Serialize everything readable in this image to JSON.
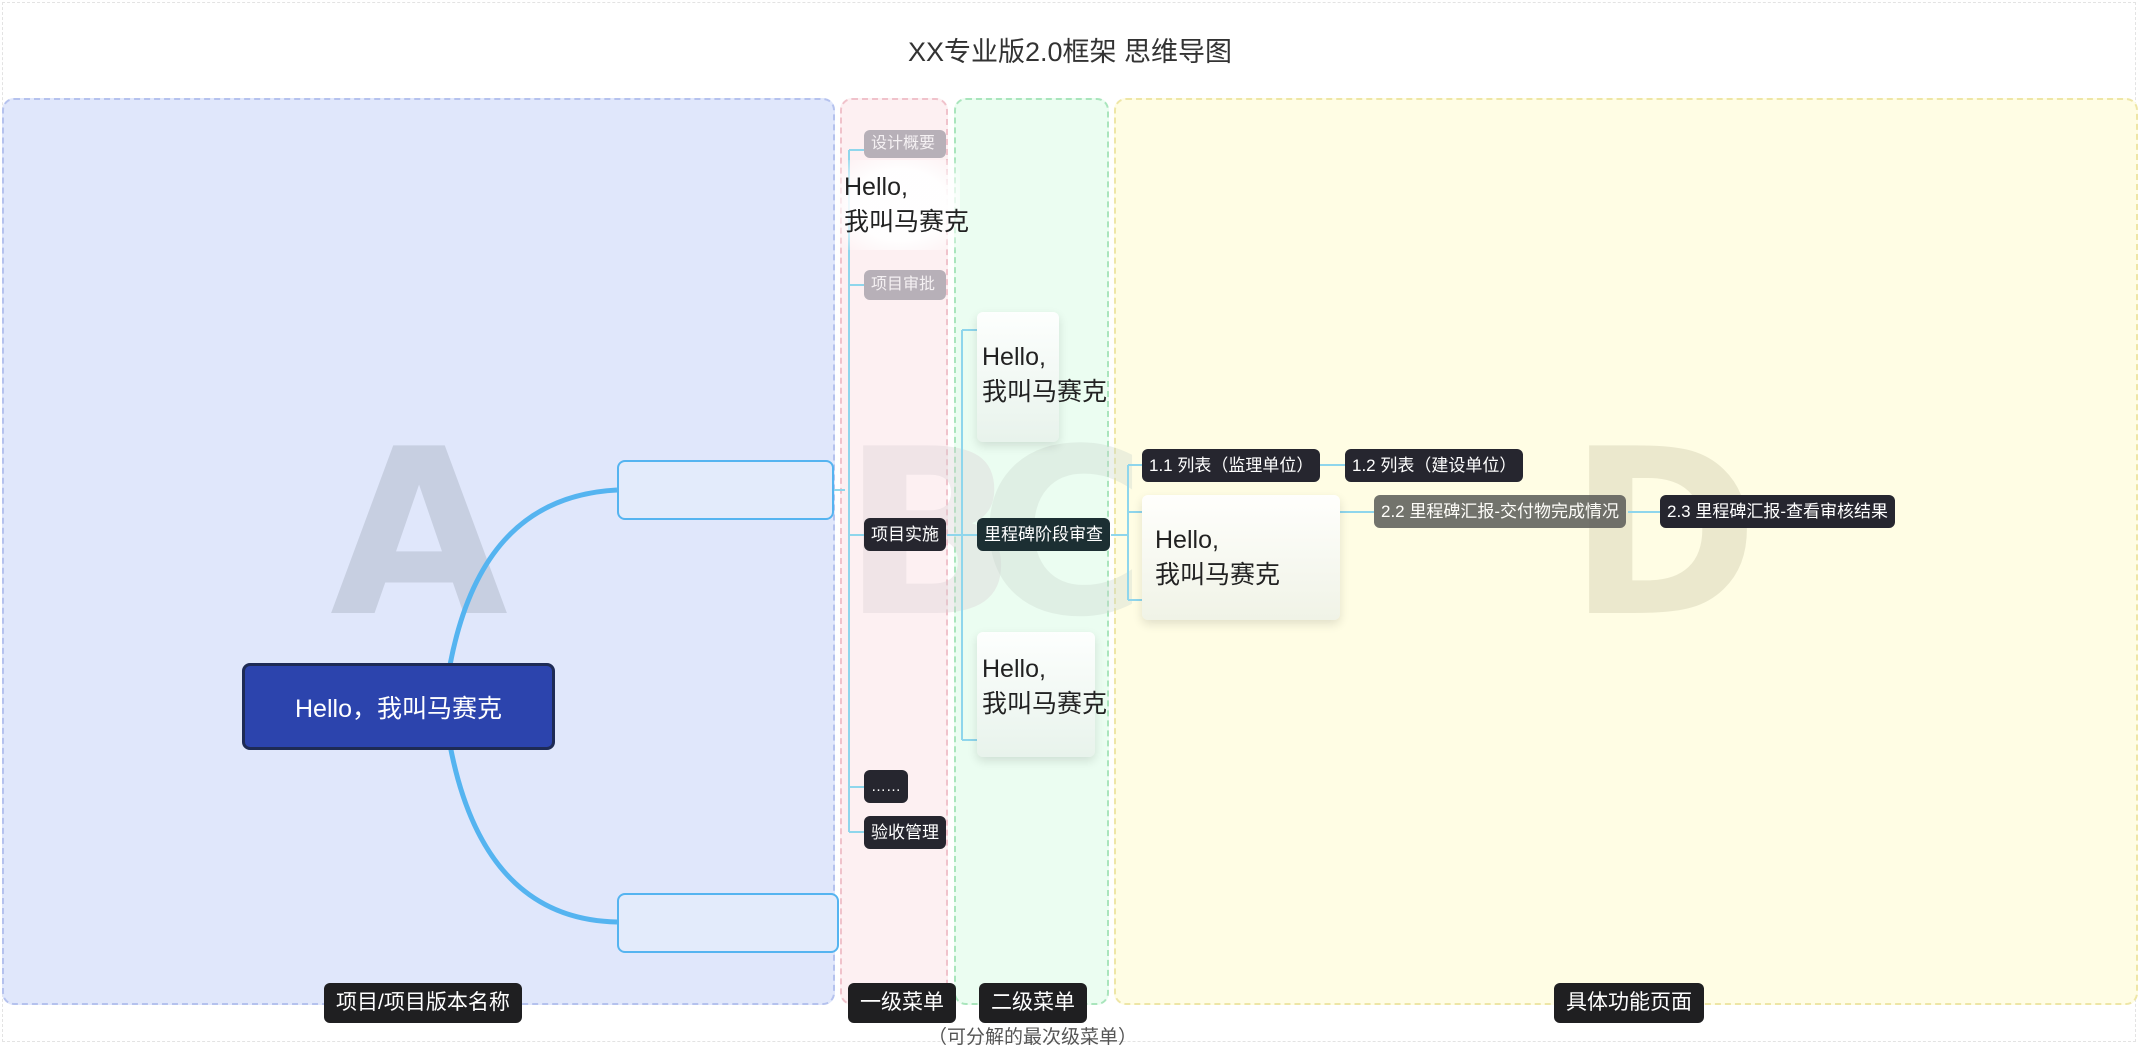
{
  "title": "XX专业版2.0框架 思维导图",
  "zone_letters": {
    "a": "A",
    "b": "B",
    "c": "C",
    "d": "D"
  },
  "central_topic": "Hello，我叫马赛克",
  "level1": {
    "design_label": "设计概要",
    "approval": "项目审批",
    "implementation": "项目实施",
    "more": "……",
    "acceptance": "验收管理"
  },
  "level2": {
    "milestone_review": "里程碑阶段审查"
  },
  "level3": {
    "list_supervision": "1.1 列表（监理单位）",
    "list_construction": "1.2 列表（建设单位）",
    "deliverables_report": "2.2 里程碑汇报-交付物完成情况",
    "review_results": "2.3 里程碑汇报-查看审核结果"
  },
  "mosaic_text": "Hello,\n我叫马赛克",
  "bottom_labels": {
    "project_name": "项目/项目版本名称",
    "menu_level1": "一级菜单",
    "menu_level2": "二级菜单",
    "feature_page": "具体功能页面"
  },
  "footnote": "（可分解的最次级菜单）",
  "colors": {
    "central_fill": "#2c44ad",
    "branch_line": "#55b4f0",
    "node_fill": "#26262f",
    "zone_a": "#e0e7fb",
    "zone_b": "#fdf0f2",
    "zone_c": "#ebfdf1",
    "zone_d": "#fffde4"
  }
}
